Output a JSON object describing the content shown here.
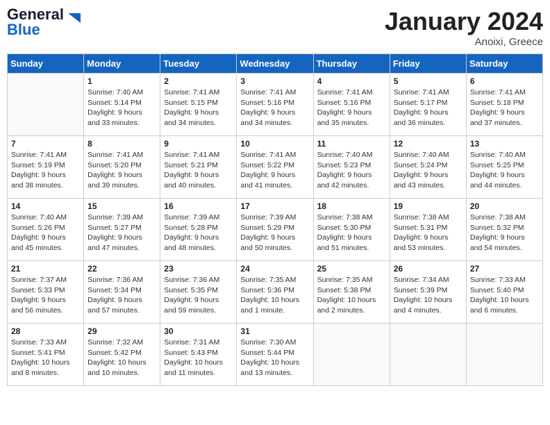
{
  "header": {
    "logo_general": "General",
    "logo_blue": "Blue",
    "month_title": "January 2024",
    "location": "Anoixi, Greece"
  },
  "weekdays": [
    "Sunday",
    "Monday",
    "Tuesday",
    "Wednesday",
    "Thursday",
    "Friday",
    "Saturday"
  ],
  "weeks": [
    [
      {
        "day": "",
        "info": ""
      },
      {
        "day": "1",
        "info": "Sunrise: 7:40 AM\nSunset: 5:14 PM\nDaylight: 9 hours\nand 33 minutes."
      },
      {
        "day": "2",
        "info": "Sunrise: 7:41 AM\nSunset: 5:15 PM\nDaylight: 9 hours\nand 34 minutes."
      },
      {
        "day": "3",
        "info": "Sunrise: 7:41 AM\nSunset: 5:16 PM\nDaylight: 9 hours\nand 34 minutes."
      },
      {
        "day": "4",
        "info": "Sunrise: 7:41 AM\nSunset: 5:16 PM\nDaylight: 9 hours\nand 35 minutes."
      },
      {
        "day": "5",
        "info": "Sunrise: 7:41 AM\nSunset: 5:17 PM\nDaylight: 9 hours\nand 36 minutes."
      },
      {
        "day": "6",
        "info": "Sunrise: 7:41 AM\nSunset: 5:18 PM\nDaylight: 9 hours\nand 37 minutes."
      }
    ],
    [
      {
        "day": "7",
        "info": "Sunrise: 7:41 AM\nSunset: 5:19 PM\nDaylight: 9 hours\nand 38 minutes."
      },
      {
        "day": "8",
        "info": "Sunrise: 7:41 AM\nSunset: 5:20 PM\nDaylight: 9 hours\nand 39 minutes."
      },
      {
        "day": "9",
        "info": "Sunrise: 7:41 AM\nSunset: 5:21 PM\nDaylight: 9 hours\nand 40 minutes."
      },
      {
        "day": "10",
        "info": "Sunrise: 7:41 AM\nSunset: 5:22 PM\nDaylight: 9 hours\nand 41 minutes."
      },
      {
        "day": "11",
        "info": "Sunrise: 7:40 AM\nSunset: 5:23 PM\nDaylight: 9 hours\nand 42 minutes."
      },
      {
        "day": "12",
        "info": "Sunrise: 7:40 AM\nSunset: 5:24 PM\nDaylight: 9 hours\nand 43 minutes."
      },
      {
        "day": "13",
        "info": "Sunrise: 7:40 AM\nSunset: 5:25 PM\nDaylight: 9 hours\nand 44 minutes."
      }
    ],
    [
      {
        "day": "14",
        "info": "Sunrise: 7:40 AM\nSunset: 5:26 PM\nDaylight: 9 hours\nand 45 minutes."
      },
      {
        "day": "15",
        "info": "Sunrise: 7:39 AM\nSunset: 5:27 PM\nDaylight: 9 hours\nand 47 minutes."
      },
      {
        "day": "16",
        "info": "Sunrise: 7:39 AM\nSunset: 5:28 PM\nDaylight: 9 hours\nand 48 minutes."
      },
      {
        "day": "17",
        "info": "Sunrise: 7:39 AM\nSunset: 5:29 PM\nDaylight: 9 hours\nand 50 minutes."
      },
      {
        "day": "18",
        "info": "Sunrise: 7:38 AM\nSunset: 5:30 PM\nDaylight: 9 hours\nand 51 minutes."
      },
      {
        "day": "19",
        "info": "Sunrise: 7:38 AM\nSunset: 5:31 PM\nDaylight: 9 hours\nand 53 minutes."
      },
      {
        "day": "20",
        "info": "Sunrise: 7:38 AM\nSunset: 5:32 PM\nDaylight: 9 hours\nand 54 minutes."
      }
    ],
    [
      {
        "day": "21",
        "info": "Sunrise: 7:37 AM\nSunset: 5:33 PM\nDaylight: 9 hours\nand 56 minutes."
      },
      {
        "day": "22",
        "info": "Sunrise: 7:36 AM\nSunset: 5:34 PM\nDaylight: 9 hours\nand 57 minutes."
      },
      {
        "day": "23",
        "info": "Sunrise: 7:36 AM\nSunset: 5:35 PM\nDaylight: 9 hours\nand 59 minutes."
      },
      {
        "day": "24",
        "info": "Sunrise: 7:35 AM\nSunset: 5:36 PM\nDaylight: 10 hours\nand 1 minute."
      },
      {
        "day": "25",
        "info": "Sunrise: 7:35 AM\nSunset: 5:38 PM\nDaylight: 10 hours\nand 2 minutes."
      },
      {
        "day": "26",
        "info": "Sunrise: 7:34 AM\nSunset: 5:39 PM\nDaylight: 10 hours\nand 4 minutes."
      },
      {
        "day": "27",
        "info": "Sunrise: 7:33 AM\nSunset: 5:40 PM\nDaylight: 10 hours\nand 6 minutes."
      }
    ],
    [
      {
        "day": "28",
        "info": "Sunrise: 7:33 AM\nSunset: 5:41 PM\nDaylight: 10 hours\nand 8 minutes."
      },
      {
        "day": "29",
        "info": "Sunrise: 7:32 AM\nSunset: 5:42 PM\nDaylight: 10 hours\nand 10 minutes."
      },
      {
        "day": "30",
        "info": "Sunrise: 7:31 AM\nSunset: 5:43 PM\nDaylight: 10 hours\nand 11 minutes."
      },
      {
        "day": "31",
        "info": "Sunrise: 7:30 AM\nSunset: 5:44 PM\nDaylight: 10 hours\nand 13 minutes."
      },
      {
        "day": "",
        "info": ""
      },
      {
        "day": "",
        "info": ""
      },
      {
        "day": "",
        "info": ""
      }
    ]
  ]
}
